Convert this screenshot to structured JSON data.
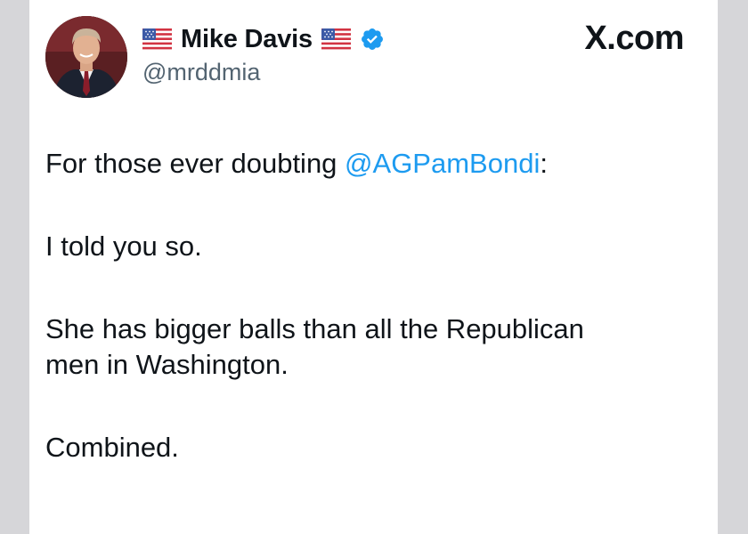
{
  "header": {
    "name": "Mike Davis",
    "handle": "@mrddmia",
    "brand": "X.com"
  },
  "tweet": {
    "line1_prefix": "For those ever doubting ",
    "mention": "@AGPamBondi",
    "line1_suffix": ":",
    "para2": "I told you so.",
    "para3_line1": "She has bigger balls than all the Republican",
    "para3_line2": "men in Washington.",
    "para4": "Combined."
  },
  "colors": {
    "link": "#1d9bf0",
    "text": "#0f1419",
    "secondary": "#536471",
    "verified": "#1d9bf0"
  },
  "icons": {
    "flag_left": "us-flag-icon",
    "flag_right": "us-flag-icon",
    "verified": "verified-badge-icon"
  }
}
